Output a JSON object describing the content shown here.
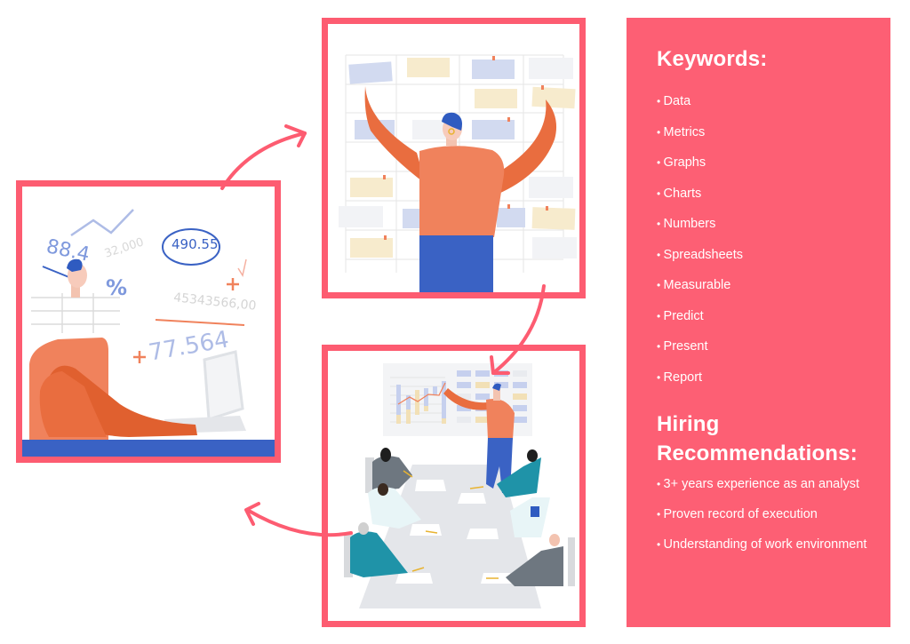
{
  "panel": {
    "keywords_heading": "Keywords:",
    "keywords": [
      "Data",
      "Metrics",
      "Graphs",
      "Charts",
      "Numbers",
      "Spreadsheets",
      "Measurable",
      "Predict",
      "Present",
      "Report"
    ],
    "hiring_heading": "Hiring Recommendations:",
    "hiring": [
      "3+ years experience as an analyst",
      "Proven record of execution",
      "Understanding of work environment"
    ]
  },
  "illustrations": {
    "left": {
      "description": "analyst at laptop surrounded by numbers",
      "numbers": [
        "88.4",
        "32,000",
        "490.55",
        "%",
        "45343566,00",
        "77.564"
      ]
    },
    "top": {
      "description": "person arranging sticky notes on board"
    },
    "bottom": {
      "description": "team meeting with presentation"
    }
  },
  "colors": {
    "accent": "#fd5c71",
    "orange": "#f0825c",
    "blue": "#3a62c4",
    "teal": "#1f93a8"
  }
}
